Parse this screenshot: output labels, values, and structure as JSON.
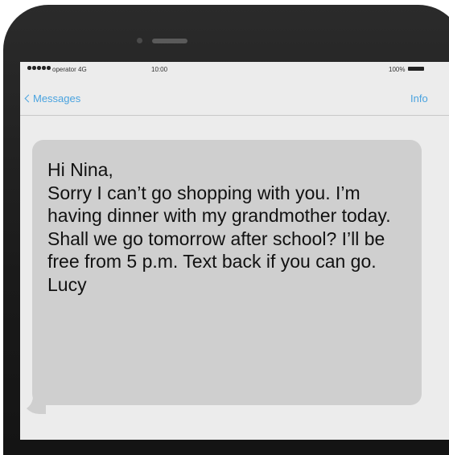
{
  "status_bar": {
    "carrier": "operator 4G",
    "time": "10:00",
    "battery": "100%"
  },
  "nav": {
    "back_label": "Messages",
    "info_label": "Info"
  },
  "message": {
    "text": "Hi Nina,\nSorry I can’t go shopping with you. I’m having dinner with my grandmother today. Shall we go tomorrow after school? I’ll be free from 5 p.m. Text back if you can go.\nLucy"
  },
  "colors": {
    "accent": "#4aa3df",
    "bubble": "#cfcfcf",
    "screen": "#ececec",
    "phone_body": "#1a1a1a"
  }
}
